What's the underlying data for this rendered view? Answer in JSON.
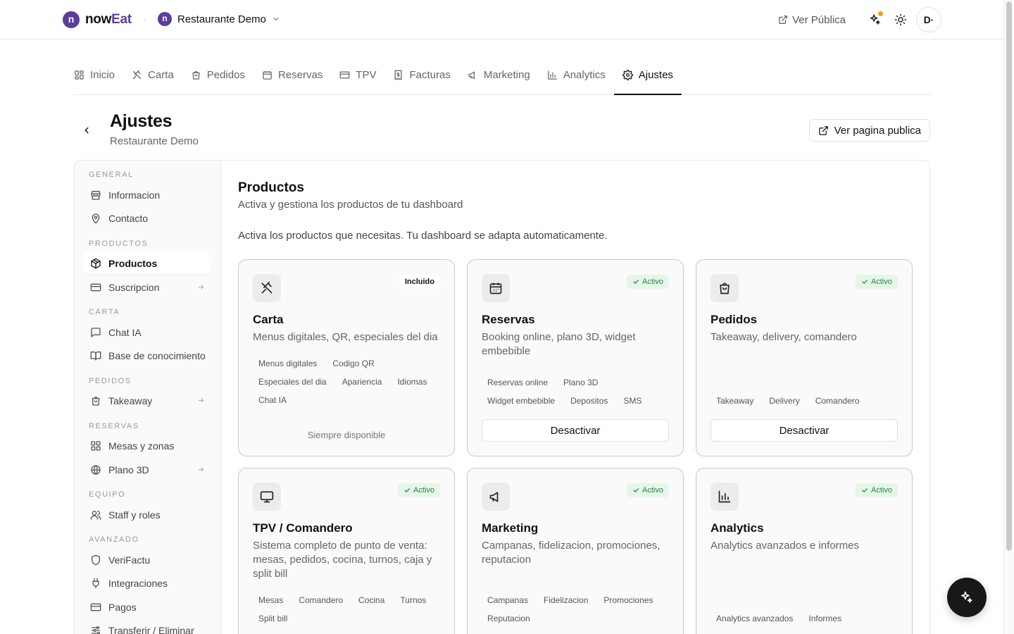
{
  "brand": {
    "logo_letter": "n",
    "name_part1": "now",
    "name_part2": "Eat",
    "accent": "#5b3c9e"
  },
  "restaurant": {
    "letter": "n",
    "name": "Restaurante Demo"
  },
  "topbar": {
    "ver_publica": "Ver Pública",
    "avatar": "D·"
  },
  "nav": {
    "tabs": [
      {
        "label": "Inicio",
        "icon": "grid-icon"
      },
      {
        "label": "Carta",
        "icon": "utensils-icon"
      },
      {
        "label": "Pedidos",
        "icon": "bag-icon"
      },
      {
        "label": "Reservas",
        "icon": "calendar-icon"
      },
      {
        "label": "TPV",
        "icon": "credit-card-icon"
      },
      {
        "label": "Facturas",
        "icon": "receipt-icon"
      },
      {
        "label": "Marketing",
        "icon": "megaphone-icon"
      },
      {
        "label": "Analytics",
        "icon": "bar-chart-icon"
      },
      {
        "label": "Ajustes",
        "icon": "gear-icon",
        "active": true
      }
    ]
  },
  "header": {
    "title": "Ajustes",
    "subtitle": "Restaurante Demo",
    "public_button": "Ver pagina publica"
  },
  "sidebar": {
    "groups": {
      "general": "GENERAL",
      "productos": "PRODUCTOS",
      "carta": "CARTA",
      "pedidos": "PEDIDOS",
      "reservas": "RESERVAS",
      "equipo": "EQUIPO",
      "avanzado": "AVANZADO"
    },
    "items": {
      "informacion": "Informacion",
      "contacto": "Contacto",
      "productos": "Productos",
      "suscripcion": "Suscripcion",
      "chat_ia": "Chat IA",
      "base_conocimiento": "Base de conocimiento",
      "takeaway": "Takeaway",
      "mesas": "Mesas y zonas",
      "plano3d": "Plano 3D",
      "staff": "Staff y roles",
      "verifactu": "VeriFactu",
      "integraciones": "Integraciones",
      "pagos": "Pagos",
      "transferir": "Transferir / Eliminar"
    }
  },
  "main": {
    "title": "Productos",
    "subtitle": "Activa y gestiona los productos de tu dashboard",
    "description": "Activa los productos que necesitas. Tu dashboard se adapta automaticamente.",
    "cards": [
      {
        "title": "Carta",
        "desc": "Menus digitales, QR, especiales del dia",
        "badge": "Incluido",
        "tags": [
          "Menus digitales",
          "Codigo QR",
          "Especiales del dia",
          "Apariencia",
          "Idiomas",
          "Chat IA"
        ],
        "footer": "Siempre disponible"
      },
      {
        "title": "Reservas",
        "desc": "Booking online, plano 3D, widget embebible",
        "badge": "Activo",
        "tags": [
          "Reservas online",
          "Plano 3D",
          "Widget embebible",
          "Depositos",
          "SMS"
        ],
        "button": "Desactivar"
      },
      {
        "title": "Pedidos",
        "desc": "Takeaway, delivery, comandero",
        "badge": "Activo",
        "tags": [
          "Takeaway",
          "Delivery",
          "Comandero"
        ],
        "button": "Desactivar"
      },
      {
        "title": "TPV / Comandero",
        "desc": "Sistema completo de punto de venta: mesas, pedidos, cocina, turnos, caja y split bill",
        "badge": "Activo",
        "tags": [
          "Mesas",
          "Comandero",
          "Cocina",
          "Turnos",
          "Split bill"
        ]
      },
      {
        "title": "Marketing",
        "desc": "Campanas, fidelizacion, promociones, reputacion",
        "badge": "Activo",
        "tags": [
          "Campanas",
          "Fidelizacion",
          "Promociones",
          "Reputacion"
        ]
      },
      {
        "title": "Analytics",
        "desc": "Analytics avanzados e informes",
        "badge": "Activo",
        "tags": [
          "Analytics avanzados",
          "Informes"
        ]
      }
    ]
  }
}
